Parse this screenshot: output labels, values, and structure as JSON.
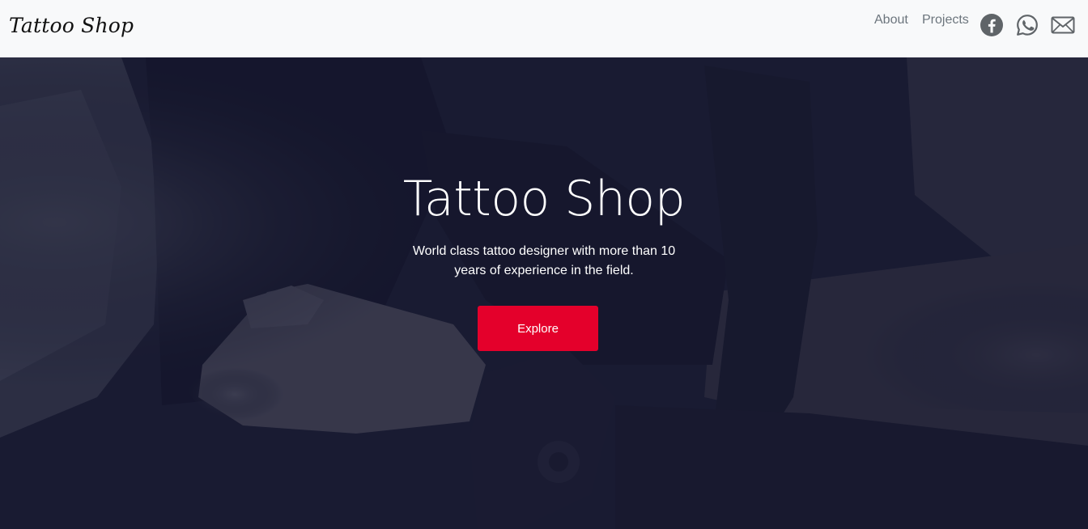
{
  "navbar": {
    "brand": "Tattoo Shop",
    "links": [
      "About",
      "Projects"
    ],
    "icons": [
      "facebook-icon",
      "whatsapp-icon",
      "mail-icon"
    ]
  },
  "hero": {
    "title": "Tattoo Shop",
    "text": "World class tattoo designer with more than 10 years of experience in the field.",
    "button_label": "Explore"
  },
  "colors": {
    "navbar_bg": "#f8f9fa",
    "nav_link": "#6c757d",
    "hero_overlay": "#161830",
    "accent": "#e4002b"
  }
}
